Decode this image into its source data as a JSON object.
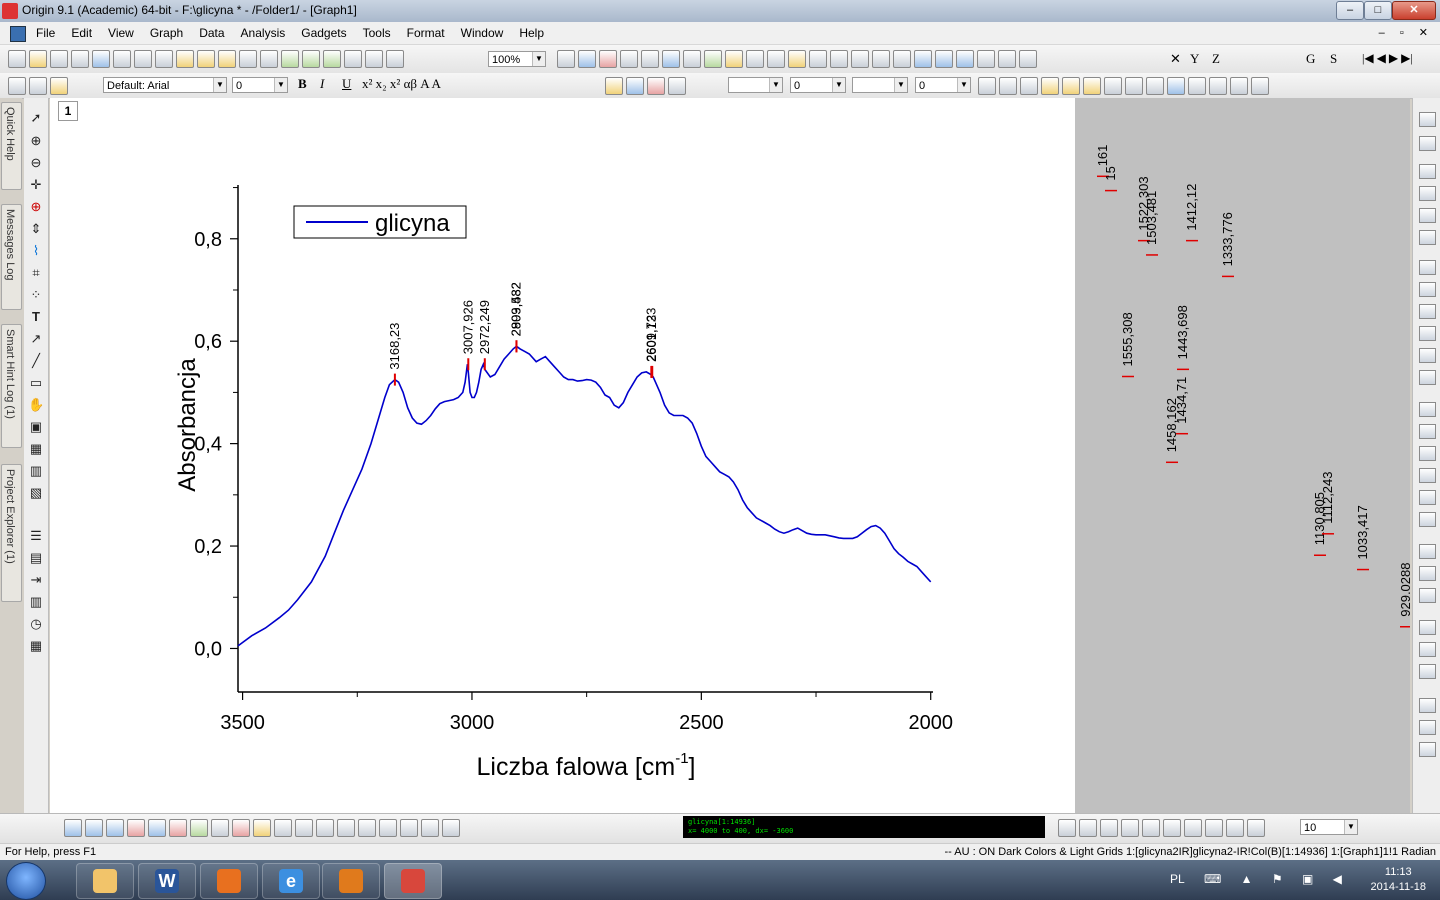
{
  "window": {
    "title": "Origin 9.1 (Academic) 64-bit - F:\\glicyna * - /Folder1/ - [Graph1]"
  },
  "menu": [
    "File",
    "Edit",
    "View",
    "Graph",
    "Data",
    "Analysis",
    "Gadgets",
    "Tools",
    "Format",
    "Window",
    "Help"
  ],
  "toolbar": {
    "zoom": "100%",
    "font": "Default: Arial",
    "font_size": "0",
    "bold": "B",
    "italic": "I",
    "underline": "U",
    "line_value": "0",
    "pattern_value": "0",
    "bottom_size": "10",
    "axis_buttons": [
      "X",
      "Y",
      "Z"
    ],
    "text_buttons": [
      "S",
      "G"
    ]
  },
  "side_tabs": [
    "Quick Help",
    "Messages Log",
    "Smart Hint Log (1)",
    "Project Explorer (1)"
  ],
  "graph": {
    "layer_number": "1"
  },
  "chart_data": {
    "type": "line",
    "xlabel": "Liczba falowa [cm",
    "xlabel_sup": "-1",
    "xlabel_close": "]",
    "ylabel": "Absorbancja",
    "xlim": [
      3510,
      1995
    ],
    "ylim": [
      -0.085,
      0.905
    ],
    "x_ticks": [
      3500,
      3000,
      2500,
      2000
    ],
    "x_tick_labels": [
      "3500",
      "3000",
      "2500",
      "2000"
    ],
    "y_ticks": [
      0.0,
      0.2,
      0.4,
      0.6,
      0.8
    ],
    "y_tick_labels": [
      "0,0",
      "0,2",
      "0,4",
      "0,6",
      "0,8"
    ],
    "legend": "top-left",
    "grid": false,
    "series": [
      {
        "name": "glicyna",
        "color": "#0000cc",
        "x": [
          3510,
          3480,
          3450,
          3420,
          3400,
          3380,
          3350,
          3320,
          3300,
          3280,
          3260,
          3240,
          3220,
          3200,
          3190,
          3180,
          3168,
          3160,
          3150,
          3140,
          3130,
          3120,
          3110,
          3100,
          3090,
          3080,
          3070,
          3060,
          3050,
          3040,
          3030,
          3020,
          3015,
          3010,
          3008,
          3004,
          3000,
          2995,
          2990,
          2985,
          2980,
          2975,
          2972,
          2968,
          2960,
          2950,
          2940,
          2930,
          2920,
          2910,
          2903,
          2895,
          2885,
          2875,
          2860,
          2850,
          2840,
          2830,
          2820,
          2810,
          2800,
          2790,
          2780,
          2770,
          2760,
          2750,
          2740,
          2730,
          2720,
          2710,
          2700,
          2690,
          2680,
          2670,
          2660,
          2650,
          2640,
          2630,
          2620,
          2610,
          2605,
          2600,
          2590,
          2580,
          2570,
          2560,
          2550,
          2540,
          2530,
          2520,
          2510,
          2500,
          2490,
          2480,
          2470,
          2460,
          2450,
          2440,
          2430,
          2420,
          2410,
          2400,
          2390,
          2380,
          2370,
          2360,
          2350,
          2340,
          2330,
          2320,
          2310,
          2300,
          2290,
          2280,
          2270,
          2260,
          2250,
          2240,
          2230,
          2220,
          2210,
          2200,
          2190,
          2180,
          2170,
          2160,
          2150,
          2140,
          2130,
          2120,
          2110,
          2100,
          2090,
          2080,
          2070,
          2060,
          2050,
          2040,
          2030,
          2020,
          2010,
          2000
        ],
        "y": [
          0.005,
          0.025,
          0.04,
          0.06,
          0.075,
          0.095,
          0.13,
          0.18,
          0.225,
          0.27,
          0.31,
          0.35,
          0.4,
          0.46,
          0.49,
          0.515,
          0.525,
          0.52,
          0.5,
          0.47,
          0.45,
          0.44,
          0.438,
          0.445,
          0.455,
          0.468,
          0.478,
          0.482,
          0.484,
          0.486,
          0.49,
          0.5,
          0.52,
          0.555,
          0.54,
          0.5,
          0.49,
          0.49,
          0.5,
          0.52,
          0.545,
          0.555,
          0.545,
          0.54,
          0.53,
          0.535,
          0.55,
          0.565,
          0.575,
          0.585,
          0.59,
          0.585,
          0.58,
          0.575,
          0.56,
          0.565,
          0.57,
          0.56,
          0.55,
          0.54,
          0.53,
          0.525,
          0.525,
          0.522,
          0.523,
          0.525,
          0.524,
          0.52,
          0.51,
          0.495,
          0.49,
          0.475,
          0.47,
          0.48,
          0.5,
          0.515,
          0.53,
          0.538,
          0.54,
          0.535,
          0.53,
          0.52,
          0.5,
          0.475,
          0.46,
          0.455,
          0.455,
          0.455,
          0.45,
          0.44,
          0.42,
          0.395,
          0.375,
          0.365,
          0.355,
          0.345,
          0.34,
          0.335,
          0.325,
          0.31,
          0.29,
          0.275,
          0.265,
          0.255,
          0.25,
          0.245,
          0.24,
          0.233,
          0.228,
          0.225,
          0.228,
          0.232,
          0.235,
          0.23,
          0.225,
          0.223,
          0.222,
          0.222,
          0.222,
          0.22,
          0.218,
          0.216,
          0.215,
          0.215,
          0.215,
          0.218,
          0.225,
          0.232,
          0.238,
          0.24,
          0.235,
          0.225,
          0.21,
          0.195,
          0.185,
          0.178,
          0.17,
          0.165,
          0.16,
          0.15,
          0.14,
          0.13
        ]
      }
    ],
    "peak_labels": [
      {
        "label": "3168,23",
        "x": 3168,
        "y": 0.525
      },
      {
        "label": "3007,926",
        "x": 3008,
        "y": 0.555
      },
      {
        "label": "2972,249",
        "x": 2972,
        "y": 0.555
      },
      {
        "label": "2899,582",
        "x": 2903,
        "y": 0.59
      },
      {
        "label": "2903,432",
        "x": 2903,
        "y": 0.59
      },
      {
        "label": "2609,723",
        "x": 2609,
        "y": 0.54
      },
      {
        "label": "2601,13",
        "x": 2607,
        "y": 0.54
      }
    ]
  },
  "offscreen_peaks": [
    {
      "label": "161",
      "top": 0.02
    },
    {
      "label": "15",
      "top": 0.04
    },
    {
      "label": "1522,303",
      "top": 0.11
    },
    {
      "label": "1503,481",
      "top": 0.13
    },
    {
      "label": "1412,12",
      "top": 0.11
    },
    {
      "label": "1333,776",
      "top": 0.16
    },
    {
      "label": "1555,308",
      "top": 0.3
    },
    {
      "label": "1443,698",
      "top": 0.29
    },
    {
      "label": "1458,162",
      "top": 0.42
    },
    {
      "label": "1434,71",
      "top": 0.38
    },
    {
      "label": "1130,805",
      "top": 0.55
    },
    {
      "label": "1112,243",
      "top": 0.52
    },
    {
      "label": "1033,417",
      "top": 0.57
    },
    {
      "label": "929,0288",
      "top": 0.65
    }
  ],
  "status_mini": {
    "line1": "glicyna[1:14936]",
    "line2": "x= 4000 to 400, dx= -3600"
  },
  "status": {
    "left": "For Help, press F1",
    "right": "-- AU : ON  Dark Colors & Light Grids  1:[glicyna2IR]glicyna2-IR!Col(B)[1:14936]  1:[Graph1]1!1  Radian"
  },
  "taskbar": {
    "apps": [
      {
        "name": "explorer",
        "color": "#f2c46a"
      },
      {
        "name": "word",
        "color": "#2a5599",
        "label": "W"
      },
      {
        "name": "firefox",
        "color": "#e8701f"
      },
      {
        "name": "ie",
        "color": "#3c8fe0",
        "label": "e"
      },
      {
        "name": "media",
        "color": "#e07a1c"
      },
      {
        "name": "origin",
        "color": "#d8473c"
      }
    ],
    "language": "PL",
    "time": "11:13",
    "date": "2014-11-18"
  }
}
